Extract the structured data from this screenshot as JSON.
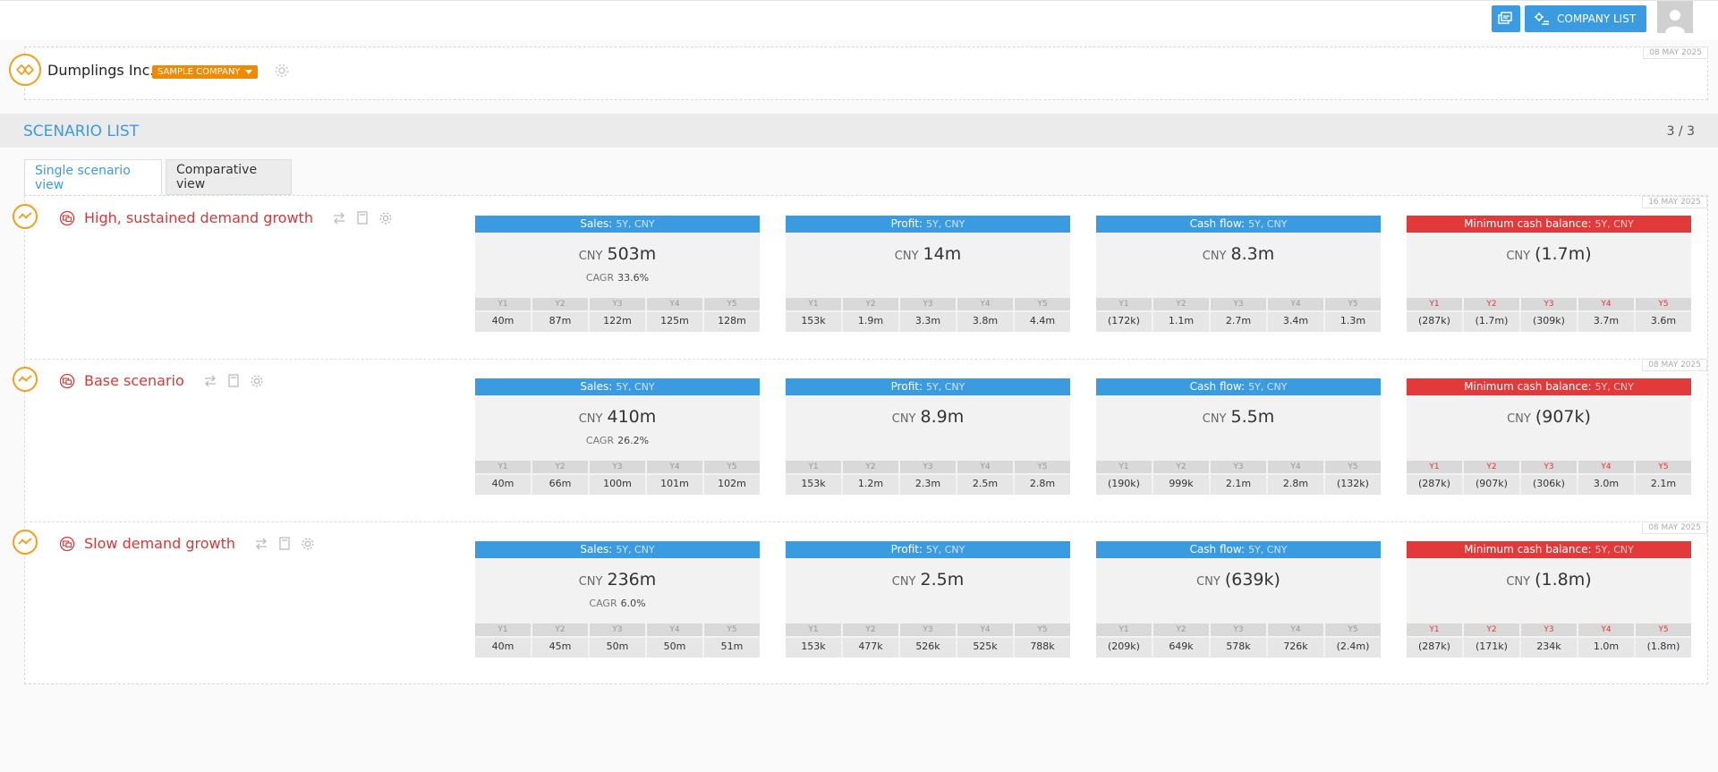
{
  "topbar": {
    "company_list_label": "COMPANY LIST"
  },
  "company": {
    "name": "Dumplings Inc.",
    "badge": "SAMPLE COMPANY",
    "date": "08 MAY 2025"
  },
  "section": {
    "title": "SCENARIO LIST",
    "count": "3 / 3"
  },
  "tabs": [
    {
      "label": "Single scenario view"
    },
    {
      "label": "Comparative view"
    }
  ],
  "colors": {
    "accent": "#3b9be0",
    "alert": "#e23a3a",
    "brand": "#f08a00",
    "title": "#d33a3a"
  },
  "scenarios": [
    {
      "title": "High, sustained demand growth",
      "date": "16 MAY 2025",
      "cards": [
        {
          "label": "Sales:",
          "sub": "5Y, CNY",
          "currency": "CNY",
          "value": "503m",
          "cagr_label": "CAGR",
          "cagr": "33.6%",
          "years": [
            "Y1",
            "Y2",
            "Y3",
            "Y4",
            "Y5"
          ],
          "values": [
            "40m",
            "87m",
            "122m",
            "125m",
            "128m"
          ]
        },
        {
          "label": "Profit:",
          "sub": "5Y, CNY",
          "currency": "CNY",
          "value": "14m",
          "years": [
            "Y1",
            "Y2",
            "Y3",
            "Y4",
            "Y5"
          ],
          "values": [
            "153k",
            "1.9m",
            "3.3m",
            "3.8m",
            "4.4m"
          ]
        },
        {
          "label": "Cash flow:",
          "sub": "5Y, CNY",
          "currency": "CNY",
          "value": "8.3m",
          "years": [
            "Y1",
            "Y2",
            "Y3",
            "Y4",
            "Y5"
          ],
          "values": [
            "(172k)",
            "1.1m",
            "2.7m",
            "3.4m",
            "1.3m"
          ]
        },
        {
          "label": "Minimum cash balance:",
          "sub": "5Y, CNY",
          "currency": "CNY",
          "value": "(1.7m)",
          "years": [
            "Y1",
            "Y2",
            "Y3",
            "Y4",
            "Y5"
          ],
          "values": [
            "(287k)",
            "(1.7m)",
            "(309k)",
            "3.7m",
            "3.6m"
          ]
        }
      ]
    },
    {
      "title": "Base scenario",
      "date": "08 MAY 2025",
      "cards": [
        {
          "label": "Sales:",
          "sub": "5Y, CNY",
          "currency": "CNY",
          "value": "410m",
          "cagr_label": "CAGR",
          "cagr": "26.2%",
          "years": [
            "Y1",
            "Y2",
            "Y3",
            "Y4",
            "Y5"
          ],
          "values": [
            "40m",
            "66m",
            "100m",
            "101m",
            "102m"
          ]
        },
        {
          "label": "Profit:",
          "sub": "5Y, CNY",
          "currency": "CNY",
          "value": "8.9m",
          "years": [
            "Y1",
            "Y2",
            "Y3",
            "Y4",
            "Y5"
          ],
          "values": [
            "153k",
            "1.2m",
            "2.3m",
            "2.5m",
            "2.8m"
          ]
        },
        {
          "label": "Cash flow:",
          "sub": "5Y, CNY",
          "currency": "CNY",
          "value": "5.5m",
          "years": [
            "Y1",
            "Y2",
            "Y3",
            "Y4",
            "Y5"
          ],
          "values": [
            "(190k)",
            "999k",
            "2.1m",
            "2.8m",
            "(132k)"
          ]
        },
        {
          "label": "Minimum cash balance:",
          "sub": "5Y, CNY",
          "currency": "CNY",
          "value": "(907k)",
          "years": [
            "Y1",
            "Y2",
            "Y3",
            "Y4",
            "Y5"
          ],
          "values": [
            "(287k)",
            "(907k)",
            "(306k)",
            "3.0m",
            "2.1m"
          ]
        }
      ]
    },
    {
      "title": "Slow demand growth",
      "date": "08 MAY 2025",
      "cards": [
        {
          "label": "Sales:",
          "sub": "5Y, CNY",
          "currency": "CNY",
          "value": "236m",
          "cagr_label": "CAGR",
          "cagr": "6.0%",
          "years": [
            "Y1",
            "Y2",
            "Y3",
            "Y4",
            "Y5"
          ],
          "values": [
            "40m",
            "45m",
            "50m",
            "50m",
            "51m"
          ]
        },
        {
          "label": "Profit:",
          "sub": "5Y, CNY",
          "currency": "CNY",
          "value": "2.5m",
          "years": [
            "Y1",
            "Y2",
            "Y3",
            "Y4",
            "Y5"
          ],
          "values": [
            "153k",
            "477k",
            "526k",
            "525k",
            "788k"
          ]
        },
        {
          "label": "Cash flow:",
          "sub": "5Y, CNY",
          "currency": "CNY",
          "value": "(639k)",
          "years": [
            "Y1",
            "Y2",
            "Y3",
            "Y4",
            "Y5"
          ],
          "values": [
            "(209k)",
            "649k",
            "578k",
            "726k",
            "(2.4m)"
          ]
        },
        {
          "label": "Minimum cash balance:",
          "sub": "5Y, CNY",
          "currency": "CNY",
          "value": "(1.8m)",
          "years": [
            "Y1",
            "Y2",
            "Y3",
            "Y4",
            "Y5"
          ],
          "values": [
            "(287k)",
            "(171k)",
            "234k",
            "1.0m",
            "(1.8m)"
          ]
        }
      ]
    }
  ]
}
